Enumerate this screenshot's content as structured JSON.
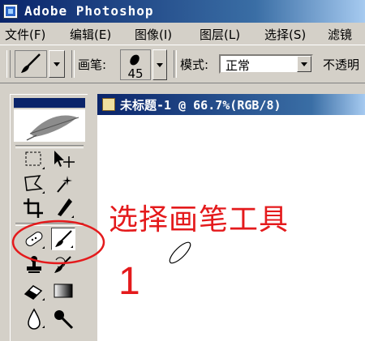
{
  "app": {
    "title": "Adobe Photoshop"
  },
  "menu": [
    "文件(F)",
    "编辑(E)",
    "图像(I)",
    "图层(L)",
    "选择(S)",
    "滤镜"
  ],
  "options_bar": {
    "brush_label": "画笔:",
    "brush_size": "45",
    "mode_label": "模式:",
    "mode_value": "正常",
    "opacity_label": "不透明"
  },
  "document": {
    "title": "未标题-1 @ 66.7%(RGB/8)"
  },
  "annotation": {
    "text": "选择画笔工具",
    "step": "1",
    "color": "#e41a1c"
  },
  "toolbox": {
    "tools": [
      "marquee-icon",
      "move-icon",
      "lasso-icon",
      "magic-wand-icon",
      "crop-icon",
      "slice-icon",
      "healing-brush-icon",
      "brush-icon",
      "clone-stamp-icon",
      "history-brush-icon",
      "eraser-icon",
      "gradient-icon",
      "blur-icon",
      "dodge-icon"
    ],
    "active_tool": "brush-icon"
  },
  "colors": {
    "title_bar": "#0a246a",
    "chrome": "#d4d0c8",
    "annotation": "#e41a1c"
  }
}
